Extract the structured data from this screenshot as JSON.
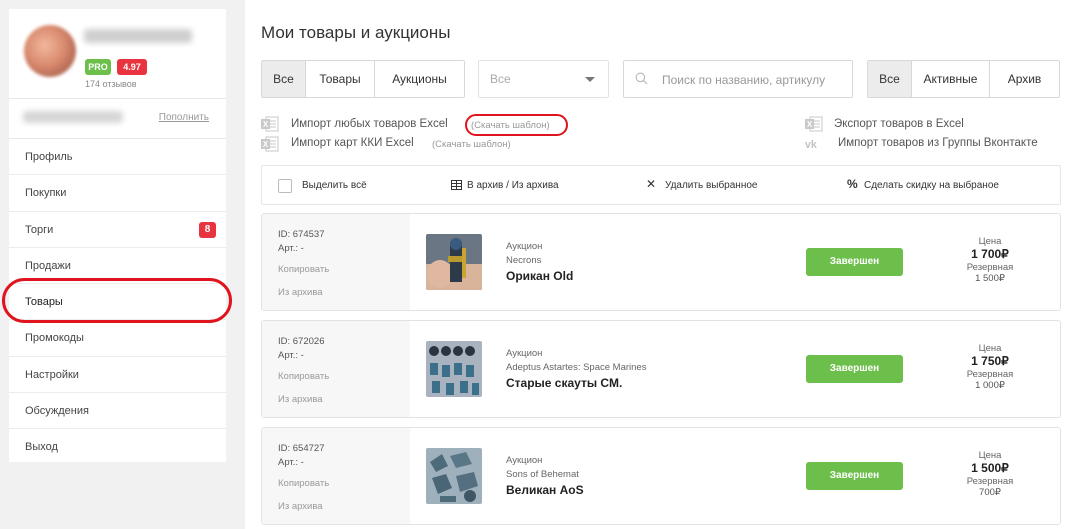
{
  "profile": {
    "pro_label": "PRO",
    "rating": "4.97",
    "reviews": "174 отзывов"
  },
  "balance": {
    "topup_label": "Пополнить"
  },
  "menu": {
    "items": [
      {
        "label": "Профиль"
      },
      {
        "label": "Покупки"
      },
      {
        "label": "Торги",
        "badge": "8"
      },
      {
        "label": "Продажи"
      },
      {
        "label": "Товары"
      },
      {
        "label": "Промокоды"
      },
      {
        "label": "Настройки"
      },
      {
        "label": "Обсуждения"
      },
      {
        "label": "Выход"
      }
    ]
  },
  "page": {
    "title": "Мои товары и аукционы"
  },
  "type_filter": {
    "all": "Все",
    "goods": "Товары",
    "auctions": "Аукционы"
  },
  "category_select": {
    "value": "Все"
  },
  "search": {
    "placeholder": "Поиск по названию, артикулу"
  },
  "status_filter": {
    "all": "Все",
    "active": "Активные",
    "archive": "Архив"
  },
  "links": {
    "import_any": "Импорт любых товаров Excel",
    "download_template_1": "(Скачать шаблон)",
    "import_cards": "Импорт карт ККИ Excel",
    "download_template_2": "(Скачать шаблон)",
    "export_excel": "Экспорт товаров в Excel",
    "import_vk": "Импорт товаров из Группы Вконтакте"
  },
  "bulk": {
    "select_all": "Выделить всё",
    "archive_toggle": "В архив / Из архива",
    "delete_selected": "Удалить выбранное",
    "discount_selected": "Сделать скидку на выбраное"
  },
  "colors": {
    "accent_green": "#6cbf4a",
    "badge_red": "#e8343f",
    "highlight_red": "#e0141e"
  },
  "items": [
    {
      "id": "ID: 674537",
      "art": "Арт.: -",
      "copy": "Копировать",
      "unarchive": "Из архива",
      "type": "Аукцион",
      "category": "Necrons",
      "title": "Орикан Old",
      "status": "Завершен",
      "price_label": "Цена",
      "price": "1 700₽",
      "reserve_label": "Резервная",
      "reserve": "1 500₽"
    },
    {
      "id": "ID: 672026",
      "art": "Арт.: -",
      "copy": "Копировать",
      "unarchive": "Из архива",
      "type": "Аукцион",
      "category": "Adeptus Astartes: Space Marines",
      "title": "Старые скауты СМ.",
      "status": "Завершен",
      "price_label": "Цена",
      "price": "1 750₽",
      "reserve_label": "Резервная",
      "reserve": "1 000₽"
    },
    {
      "id": "ID: 654727",
      "art": "Арт.: -",
      "copy": "Копировать",
      "unarchive": "Из архива",
      "type": "Аукцион",
      "category": "Sons of Behemat",
      "title": "Великан AoS",
      "status": "Завершен",
      "price_label": "Цена",
      "price": "1 500₽",
      "reserve_label": "Резервная",
      "reserve": "700₽"
    }
  ]
}
